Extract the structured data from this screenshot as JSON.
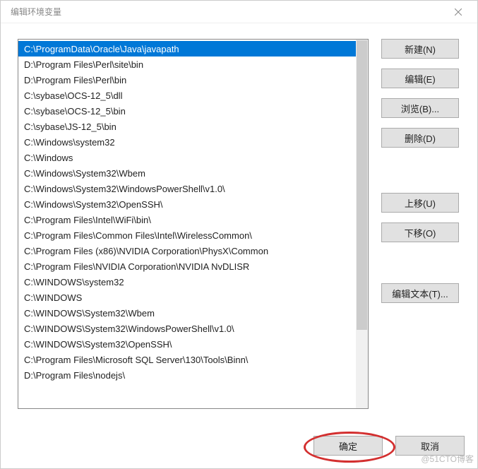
{
  "title": "编辑环境变量",
  "list": {
    "items": [
      "C:\\ProgramData\\Oracle\\Java\\javapath",
      "D:\\Program Files\\Perl\\site\\bin",
      "D:\\Program Files\\Perl\\bin",
      "C:\\sybase\\OCS-12_5\\dll",
      "C:\\sybase\\OCS-12_5\\bin",
      "C:\\sybase\\JS-12_5\\bin",
      "C:\\Windows\\system32",
      "C:\\Windows",
      "C:\\Windows\\System32\\Wbem",
      "C:\\Windows\\System32\\WindowsPowerShell\\v1.0\\",
      "C:\\Windows\\System32\\OpenSSH\\",
      "C:\\Program Files\\Intel\\WiFi\\bin\\",
      "C:\\Program Files\\Common Files\\Intel\\WirelessCommon\\",
      "C:\\Program Files (x86)\\NVIDIA Corporation\\PhysX\\Common",
      "C:\\Program Files\\NVIDIA Corporation\\NVIDIA NvDLISR",
      "C:\\WINDOWS\\system32",
      "C:\\WINDOWS",
      "C:\\WINDOWS\\System32\\Wbem",
      "C:\\WINDOWS\\System32\\WindowsPowerShell\\v1.0\\",
      "C:\\WINDOWS\\System32\\OpenSSH\\",
      "C:\\Program Files\\Microsoft SQL Server\\130\\Tools\\Binn\\",
      "D:\\Program Files\\nodejs\\"
    ],
    "selectedIndex": 0
  },
  "buttons": {
    "new": "新建(N)",
    "edit": "编辑(E)",
    "browse": "浏览(B)...",
    "delete": "删除(D)",
    "moveUp": "上移(U)",
    "moveDown": "下移(O)",
    "editText": "编辑文本(T)...",
    "ok": "确定",
    "cancel": "取消"
  },
  "watermark": "@51CTO博客"
}
